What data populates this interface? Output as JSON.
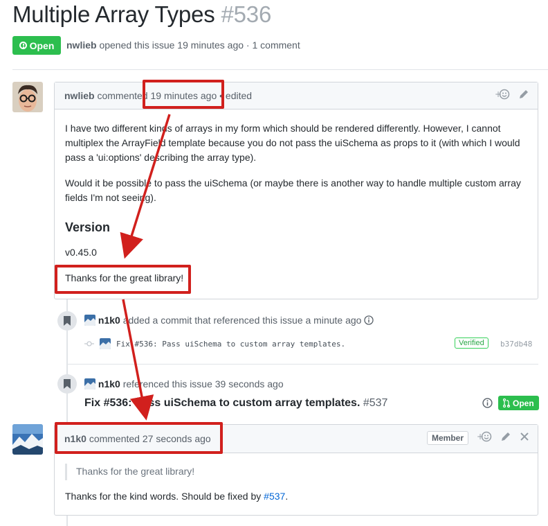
{
  "issue": {
    "title": "Multiple Array Types",
    "number": "#536",
    "state": "Open",
    "author": "nwlieb",
    "meta_text": "opened this issue 19 minutes ago · 1 comment"
  },
  "comment1": {
    "author": "nwlieb",
    "action": "commented",
    "time": "19 minutes ago",
    "edited": "edited",
    "paragraph1": "I have two different kinds of arrays in my form which should be rendered differently. However, I cannot multiplex the ArrayField template because you do not pass the uiSchema as props to it (with which I would pass a 'ui:options' describing the array type).",
    "paragraph2": "Would it be possible to pass the uiSchema (or maybe there is another way to handle multiple custom array fields I'm not seeing).",
    "heading": "Version",
    "version": "v0.45.0",
    "thanks": "Thanks for the great library!"
  },
  "event_commit": {
    "actor": "n1k0",
    "text": "added a commit that referenced this issue a minute ago",
    "commit_message": "Fix #536: Pass uiSchema to custom array templates.",
    "verified": "Verified",
    "sha": "b37db48"
  },
  "event_ref": {
    "actor": "n1k0",
    "text": "referenced this issue 39 seconds ago",
    "pr_title": "Fix #536: Pass uiSchema to custom array templates.",
    "pr_number": "#537",
    "pr_state": "Open"
  },
  "comment2": {
    "author": "n1k0",
    "action": "commented",
    "time": "27 seconds ago",
    "role": "Member",
    "quote": "Thanks for the great library!",
    "reply_prefix": "Thanks for the kind words. Should be fixed by",
    "reply_link": "#537",
    "reply_suffix": "."
  },
  "icons": {
    "reaction": "smiley-icon",
    "edit": "pencil-icon",
    "close": "close-icon",
    "bookmark": "bookmark-icon",
    "info": "info-icon",
    "pr": "git-pull-request-icon",
    "commit": "git-commit-icon"
  },
  "colors": {
    "open_green": "#2cbe4e",
    "annotation_red": "#d1201d",
    "link_blue": "#0366d6"
  }
}
